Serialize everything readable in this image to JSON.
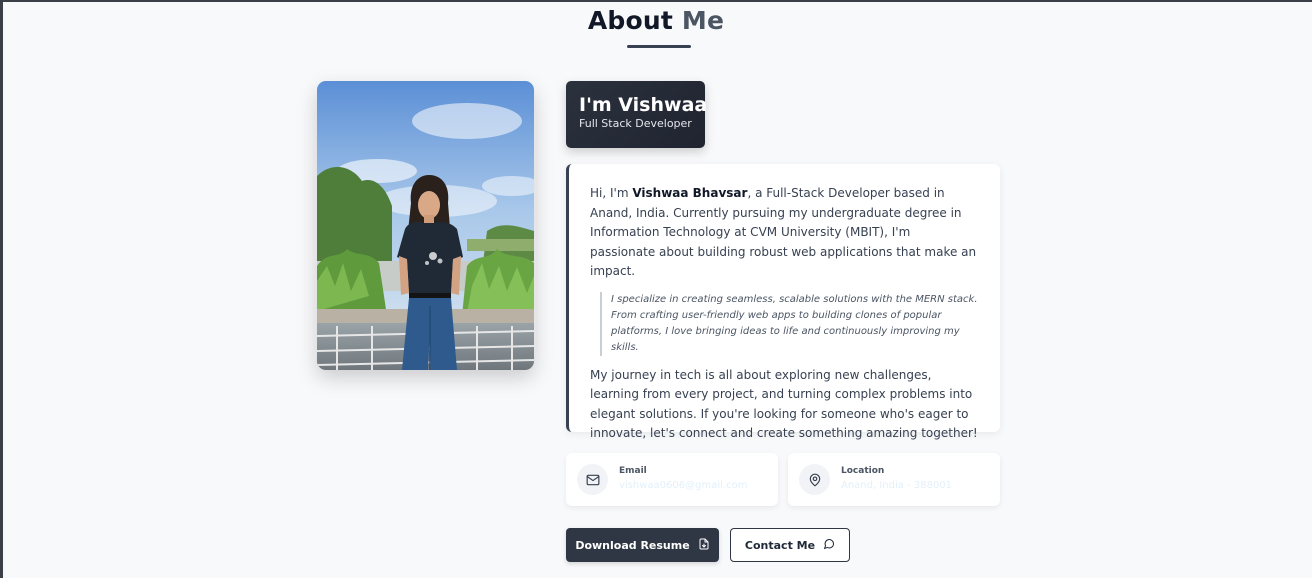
{
  "section": {
    "title_main": "About",
    "title_accent": "Me"
  },
  "intro": {
    "greeting": "I'm Vishwaa",
    "role": "Full Stack Developer"
  },
  "bio": {
    "p1_prefix": "Hi, I'm ",
    "p1_name": "Vishwaa Bhavsar",
    "p1_suffix": ", a Full-Stack Developer based in Anand, India. Currently pursuing my undergraduate degree in Information Technology at CVM University (MBIT), I'm passionate about building robust web applications that make an impact.",
    "quote": "I specialize in creating seamless, scalable solutions with the MERN stack. From crafting user-friendly web apps to building clones of popular platforms, I love bringing ideas to life and continuously improving my skills.",
    "p2": "My journey in tech is all about exploring new challenges, learning from every project, and turning complex problems into elegant solutions. If you're looking for someone who's eager to innovate, let's connect and create something amazing together!"
  },
  "contact": {
    "email_label": "Email",
    "email_value": "vishwaa0606@gmail.com",
    "email_icon": "mail-icon",
    "location_label": "Location",
    "location_value": "Anand, India - 388001",
    "location_icon": "map-pin-icon"
  },
  "actions": {
    "download_label": "Download Resume",
    "download_icon": "file-download-icon",
    "contact_label": "Contact Me",
    "contact_icon": "message-circle-icon"
  },
  "colors": {
    "background": "#f8f9fb",
    "primary": "#2f3644",
    "accent_text": "#4b5563",
    "contact_value_text": "#e3f0fa"
  }
}
